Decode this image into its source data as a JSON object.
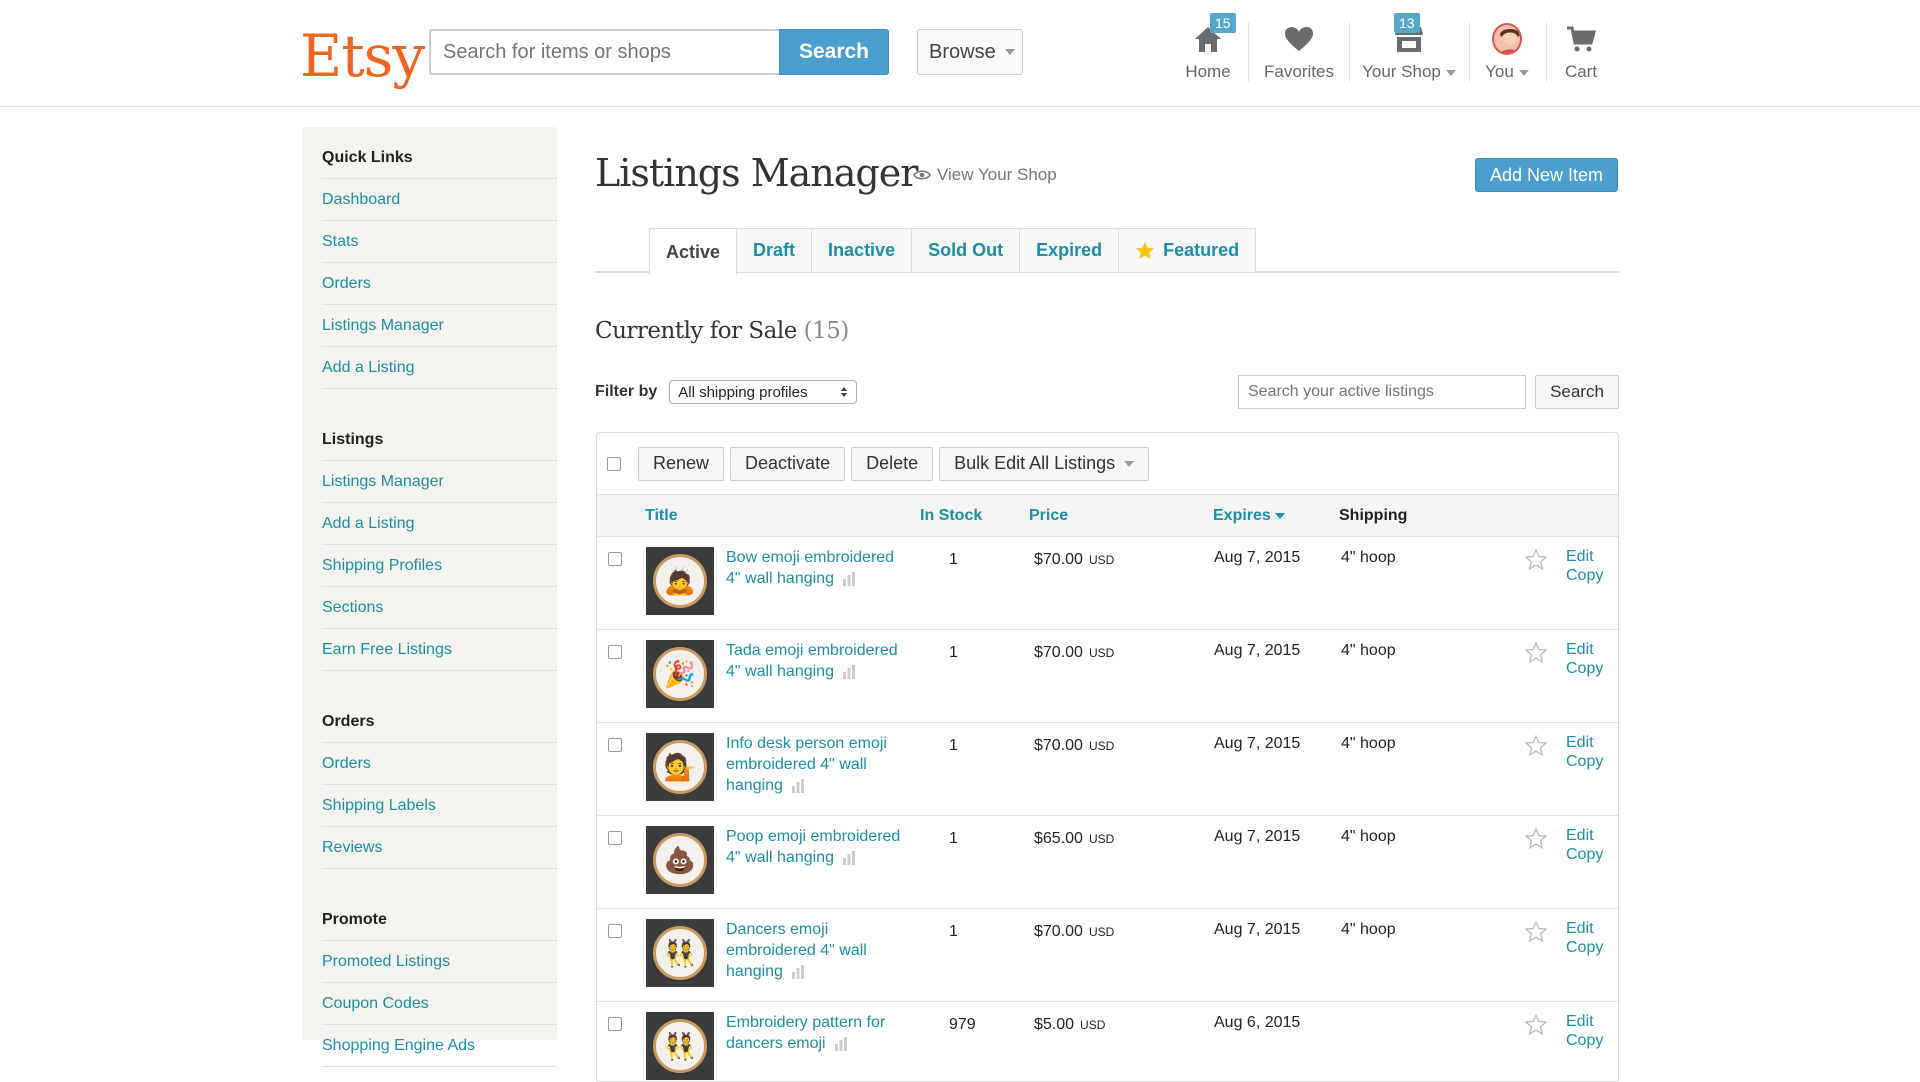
{
  "header": {
    "logo": "Etsy",
    "search_placeholder": "Search for items or shops",
    "search_button": "Search",
    "browse": "Browse",
    "nav": {
      "home": {
        "label": "Home",
        "badge": "15"
      },
      "favorites": {
        "label": "Favorites"
      },
      "your_shop": {
        "label": "Your Shop",
        "badge": "13"
      },
      "you": {
        "label": "You"
      },
      "cart": {
        "label": "Cart"
      }
    }
  },
  "sidebar": {
    "quick_links": {
      "title": "Quick Links",
      "items": [
        "Dashboard",
        "Stats",
        "Orders",
        "Listings Manager",
        "Add a Listing"
      ]
    },
    "listings": {
      "title": "Listings",
      "items": [
        "Listings Manager",
        "Add a Listing",
        "Shipping Profiles",
        "Sections",
        "Earn Free Listings"
      ]
    },
    "orders": {
      "title": "Orders",
      "items": [
        "Orders",
        "Shipping Labels",
        "Reviews"
      ]
    },
    "promote": {
      "title": "Promote",
      "items": [
        "Promoted Listings",
        "Coupon Codes",
        "Shopping Engine Ads"
      ]
    }
  },
  "main": {
    "title": "Listings Manager",
    "view_shop": "View Your Shop",
    "add_new": "Add New Item",
    "tabs": [
      "Active",
      "Draft",
      "Inactive",
      "Sold Out",
      "Expired",
      "Featured"
    ],
    "section_title": "Currently for Sale",
    "section_count": "(15)",
    "filter_label": "Filter by",
    "filter_value": "All shipping profiles",
    "listing_search_placeholder": "Search your active listings",
    "listing_search_button": "Search",
    "toolbar": {
      "renew": "Renew",
      "deactivate": "Deactivate",
      "delete": "Delete",
      "bulk_edit": "Bulk Edit All Listings"
    },
    "columns": {
      "title": "Title",
      "in_stock": "In Stock",
      "price": "Price",
      "expires": "Expires",
      "shipping": "Shipping"
    },
    "action_edit": "Edit",
    "action_copy": "Copy",
    "rows": [
      {
        "title": "Bow emoji embroidered 4\" wall hanging",
        "stock": "1",
        "price": "$70.00",
        "currency": "USD",
        "expires": "Aug 7, 2015",
        "shipping": "4\" hoop",
        "emoji": "🙇"
      },
      {
        "title": "Tada emoji embroidered 4\" wall hanging",
        "stock": "1",
        "price": "$70.00",
        "currency": "USD",
        "expires": "Aug 7, 2015",
        "shipping": "4\" hoop",
        "emoji": "🎉"
      },
      {
        "title": "Info desk person emoji embroidered 4\" wall hanging",
        "stock": "1",
        "price": "$70.00",
        "currency": "USD",
        "expires": "Aug 7, 2015",
        "shipping": "4\" hoop",
        "emoji": "💁"
      },
      {
        "title": "Poop emoji embroidered 4\" wall hanging",
        "stock": "1",
        "price": "$65.00",
        "currency": "USD",
        "expires": "Aug 7, 2015",
        "shipping": "4\" hoop",
        "emoji": "💩"
      },
      {
        "title": "Dancers emoji embroidered 4\" wall hanging",
        "stock": "1",
        "price": "$70.00",
        "currency": "USD",
        "expires": "Aug 7, 2015",
        "shipping": "4\" hoop",
        "emoji": "👯"
      },
      {
        "title": "Embroidery pattern for dancers emoji",
        "stock": "979",
        "price": "$5.00",
        "currency": "USD",
        "expires": "Aug 6, 2015",
        "shipping": "",
        "emoji": "👯"
      }
    ]
  }
}
